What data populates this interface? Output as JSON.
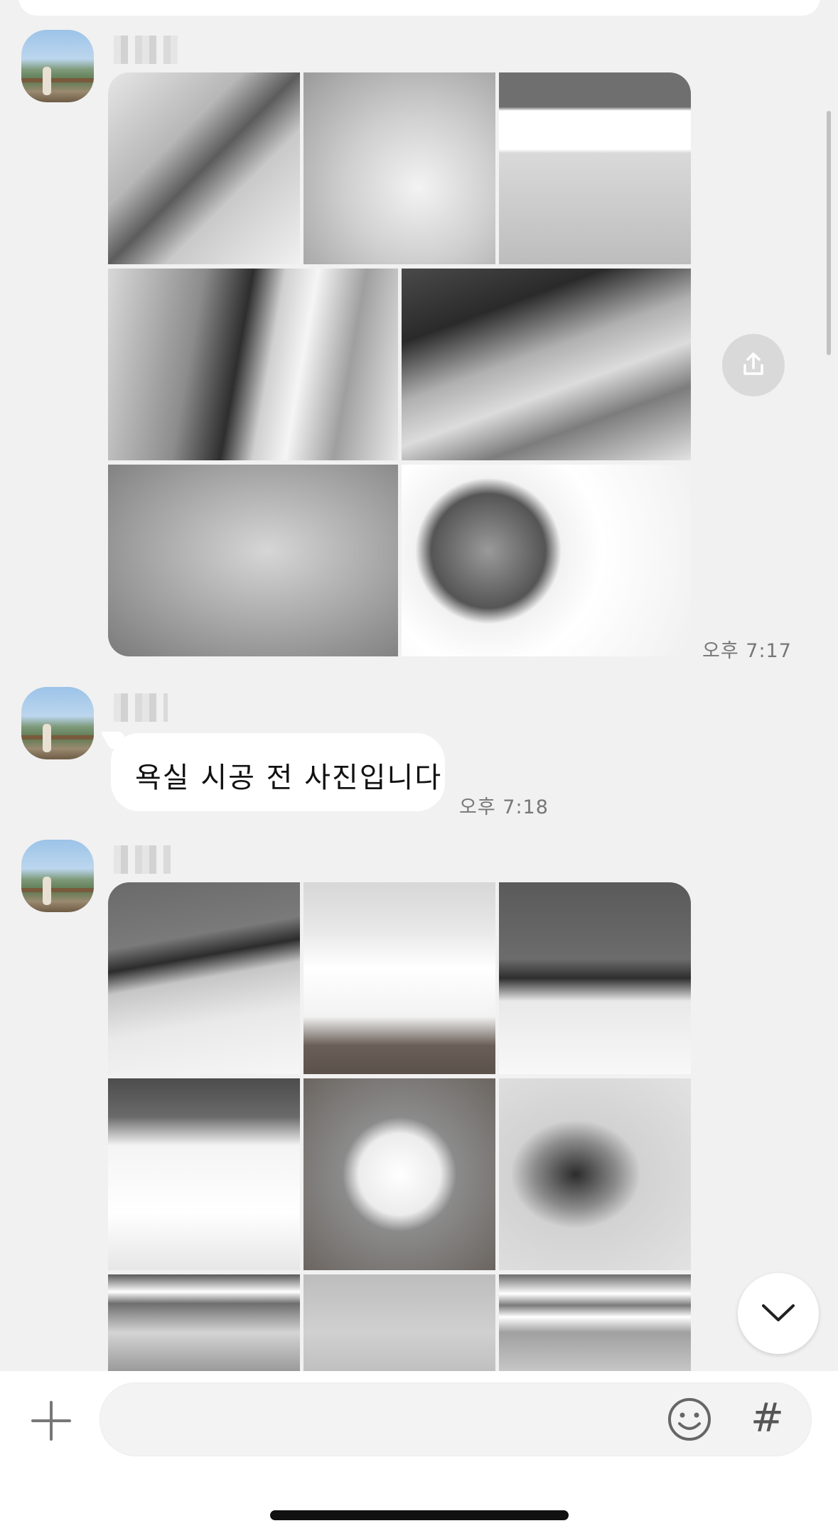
{
  "messages": [
    {
      "sender": "",
      "type": "photos",
      "time": "오후 7:17"
    },
    {
      "sender": "",
      "type": "text",
      "text": "욕실 시공 전 사진입니다",
      "time": "오후 7:18"
    },
    {
      "sender": "",
      "type": "photos"
    }
  ],
  "icons": {
    "share": "share-icon",
    "scroll_down": "chevron-down-icon",
    "add": "plus-icon",
    "emoji": "emoji-icon",
    "hashtag": "hashtag-icon"
  },
  "input": {
    "placeholder": "",
    "hashtag_label": "#"
  }
}
